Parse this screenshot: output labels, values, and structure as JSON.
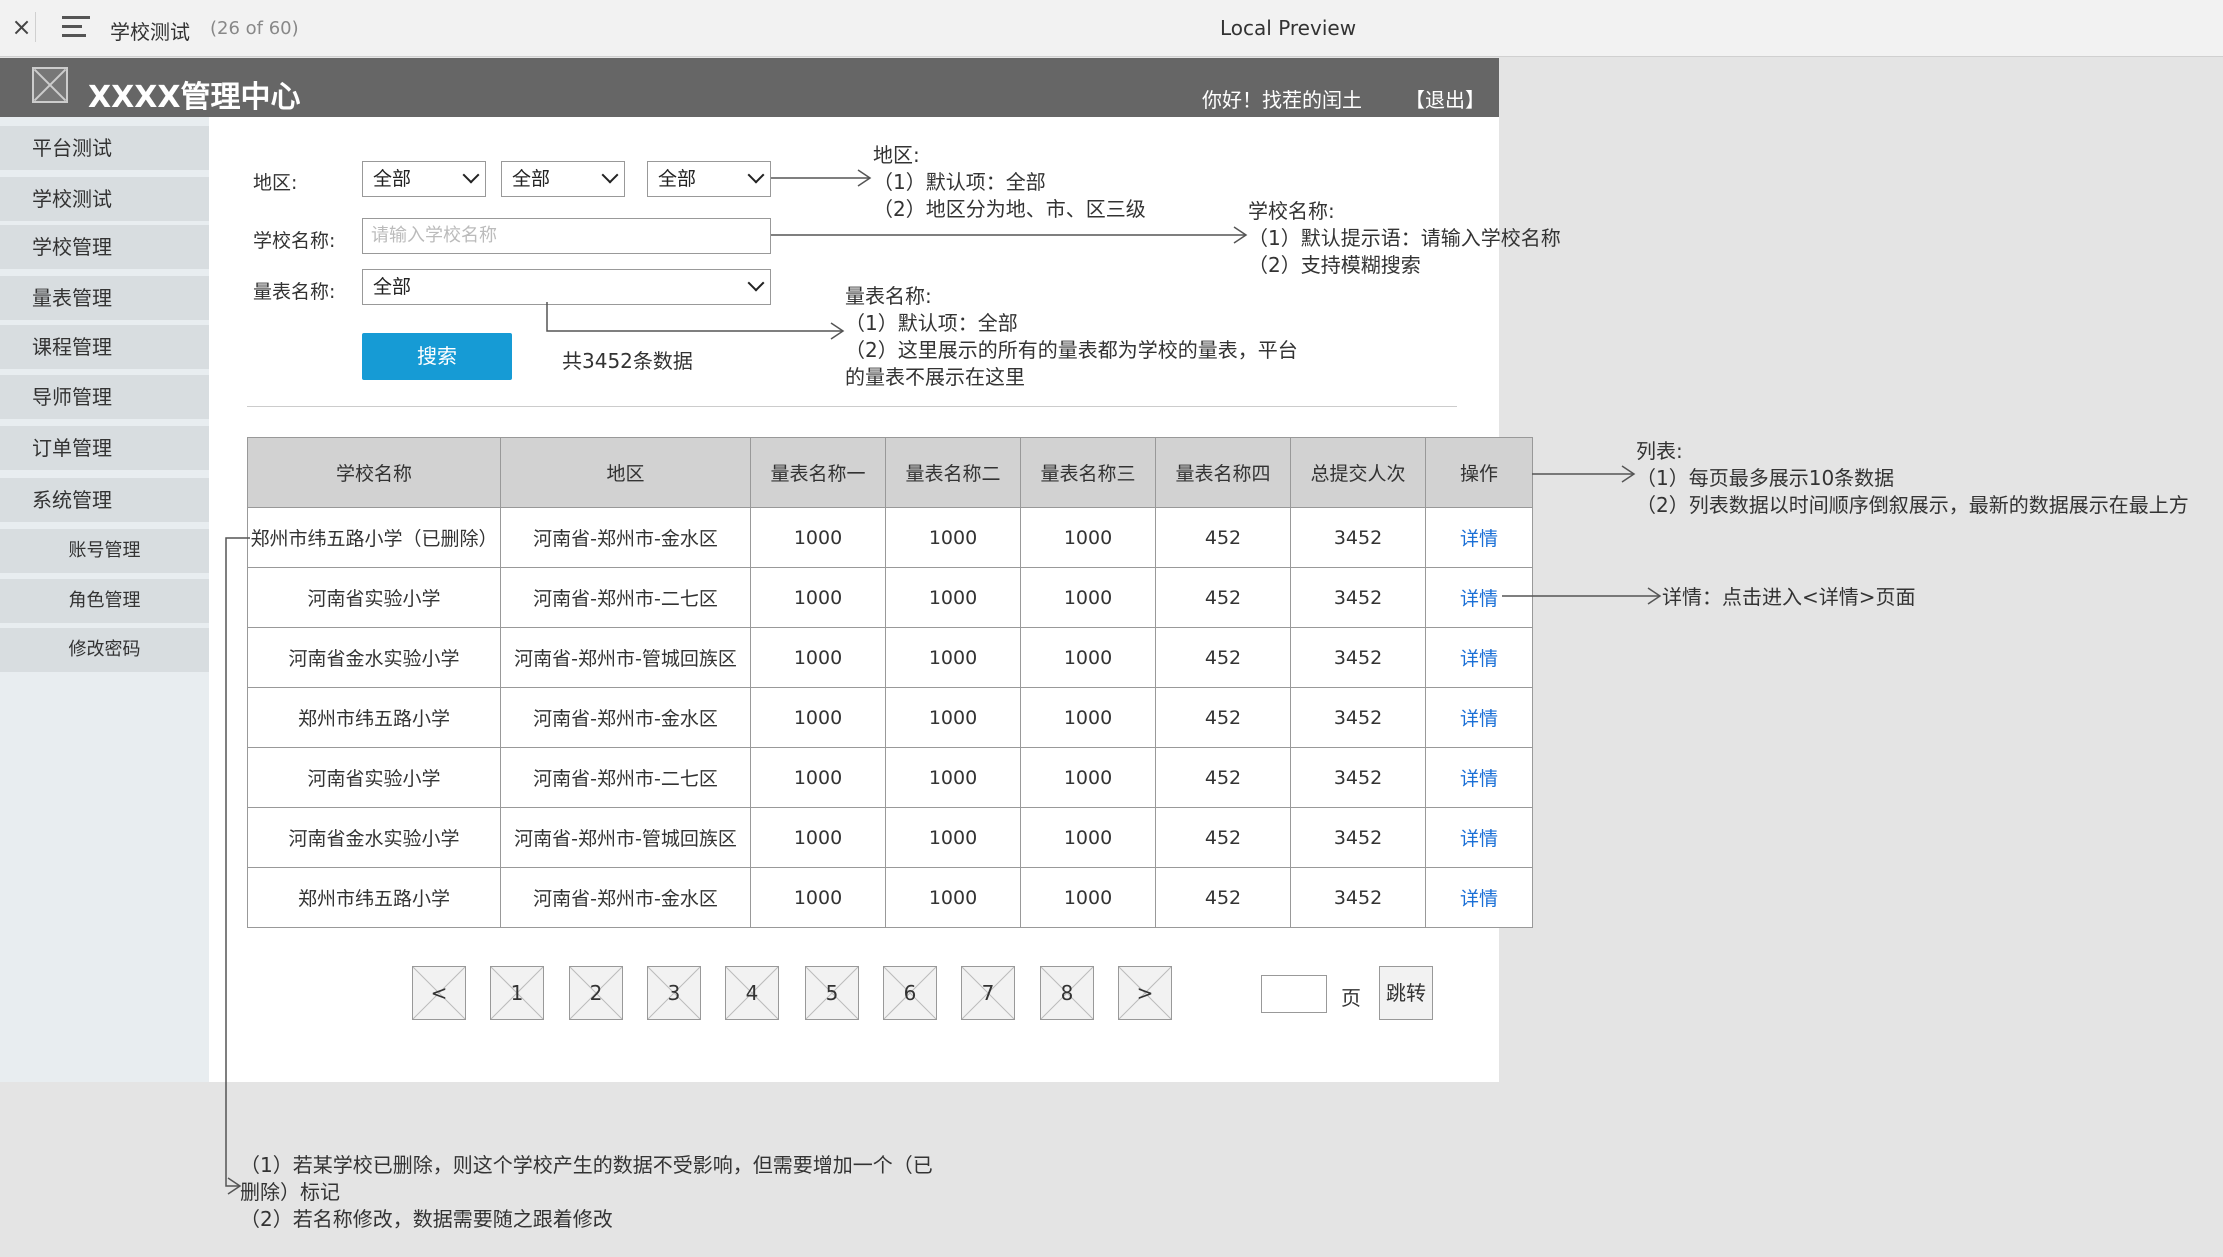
{
  "app": {
    "close_icon": "×",
    "title": "学校测试",
    "count": "(26 of 60)",
    "preview": "Local Preview"
  },
  "header": {
    "brand": "XXXX管理中心",
    "greeting": "你好！找茬的闰土",
    "logout": "【退出】"
  },
  "sidebar": {
    "items": [
      "平台测试",
      "学校测试",
      "学校管理",
      "量表管理",
      "课程管理",
      "导师管理",
      "订单管理",
      "系统管理"
    ],
    "subitems": [
      "账号管理",
      "角色管理",
      "修改密码"
    ]
  },
  "filters": {
    "region_label": "地区:",
    "region_values": [
      "全部",
      "全部",
      "全部"
    ],
    "school_label": "学校名称:",
    "school_placeholder": "请输入学校名称",
    "scale_label": "量表名称:",
    "scale_value": "全部",
    "search_button": "搜索",
    "total": "共3452条数据"
  },
  "table": {
    "headers": [
      "学校名称",
      "地区",
      "量表名称一",
      "量表名称二",
      "量表名称三",
      "量表名称四",
      "总提交人次",
      "操作"
    ],
    "rows": [
      [
        "郑州市纬五路小学（已删除）",
        "河南省-郑州市-金水区",
        "1000",
        "1000",
        "1000",
        "452",
        "3452",
        "详情"
      ],
      [
        "河南省实验小学",
        "河南省-郑州市-二七区",
        "1000",
        "1000",
        "1000",
        "452",
        "3452",
        "详情"
      ],
      [
        "河南省金水实验小学",
        "河南省-郑州市-管城回族区",
        "1000",
        "1000",
        "1000",
        "452",
        "3452",
        "详情"
      ],
      [
        "郑州市纬五路小学",
        "河南省-郑州市-金水区",
        "1000",
        "1000",
        "1000",
        "452",
        "3452",
        "详情"
      ],
      [
        "河南省实验小学",
        "河南省-郑州市-二七区",
        "1000",
        "1000",
        "1000",
        "452",
        "3452",
        "详情"
      ],
      [
        "河南省金水实验小学",
        "河南省-郑州市-管城回族区",
        "1000",
        "1000",
        "1000",
        "452",
        "3452",
        "详情"
      ],
      [
        "郑州市纬五路小学",
        "河南省-郑州市-金水区",
        "1000",
        "1000",
        "1000",
        "452",
        "3452",
        "详情"
      ]
    ]
  },
  "pagination": {
    "prev": "<",
    "pages": [
      "1",
      "2",
      "3",
      "4",
      "5",
      "6",
      "7",
      "8"
    ],
    "next": ">",
    "page_word": "页",
    "jump": "跳转"
  },
  "annotations": {
    "region": [
      "地区:",
      "（1）默认项：全部",
      "（2）地区分为地、市、区三级"
    ],
    "school": [
      "学校名称:",
      "（1）默认提示语：请输入学校名称",
      "（2）支持模糊搜索"
    ],
    "scale": [
      "量表名称:",
      "（1）默认项：全部",
      "（2）这里展示的所有的量表都为学校的量表，平台",
      "的量表不展示在这里"
    ],
    "list": [
      "列表:",
      "（1）每页最多展示10条数据",
      "（2）列表数据以时间顺序倒叙展示，最新的数据展示在最上方"
    ],
    "detail": "详情：点击进入<详情>页面",
    "deleted": [
      "（1）若某学校已删除，则这个学校产生的数据不受影响，但需要增加一个（已",
      "删除）标记",
      "（2）若名称修改，数据需要随之跟着修改"
    ]
  }
}
